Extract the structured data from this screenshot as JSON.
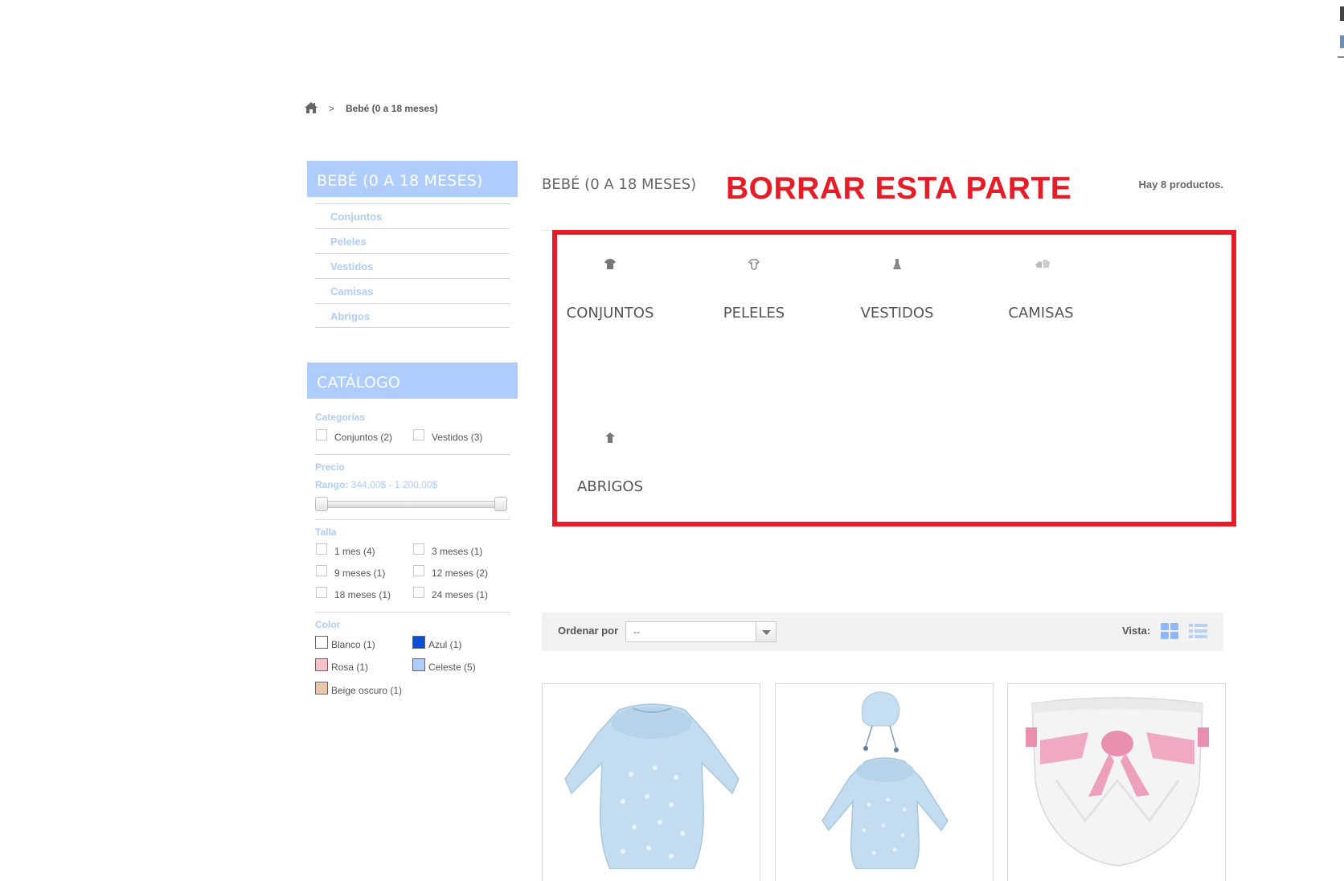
{
  "breadcrumb": {
    "separator": ">",
    "current": "Bebé (0 a 18 meses)"
  },
  "sidebar": {
    "category_block_title": "BEBÉ (0 A 18 MESES)",
    "subcategories": [
      "Conjuntos",
      "Peleles",
      "Vestidos",
      "Camisas",
      "Abrigos"
    ],
    "catalog_block_title": "CATÁLOGO"
  },
  "filters": {
    "categories": {
      "label": "Categorías",
      "options": [
        "Conjuntos (2)",
        "Vestidos (3)"
      ]
    },
    "price": {
      "label": "Precio",
      "range_label": "Rango:",
      "range_value": "344,00$ - 1 200,00$",
      "slider_low_fraction": 0,
      "slider_high_fraction": 1
    },
    "size": {
      "label": "Talla",
      "options": [
        "1 mes (4)",
        "3 meses (1)",
        "9 meses (1)",
        "12 meses (2)",
        "18 meses (1)",
        "24 meses (1)"
      ]
    },
    "color": {
      "label": "Color",
      "options": [
        {
          "label": "Blanco (1)",
          "swatch": "#ffffff"
        },
        {
          "label": "Azul (1)",
          "swatch": "#0a4fd6"
        },
        {
          "label": "Rosa (1)",
          "swatch": "#f6c1c8"
        },
        {
          "label": "Celeste (5)",
          "swatch": "#aecdfd"
        },
        {
          "label": "Beige oscuro (1)",
          "swatch": "#e8c7a8"
        }
      ]
    }
  },
  "main": {
    "title": "BEBÉ (0 A 18 MESES)",
    "annotation": "BORRAR ESTA PARTE",
    "product_count": "Hay 8 productos.",
    "subcategory_tiles": [
      {
        "label": "CONJUNTOS",
        "icon": "shirt-icon"
      },
      {
        "label": "PELELES",
        "icon": "onesie-icon"
      },
      {
        "label": "VESTIDOS",
        "icon": "dress-icon"
      },
      {
        "label": "CAMISAS",
        "icon": "baby-clothes-icon"
      },
      {
        "label": "ABRIGOS",
        "icon": "coat-icon"
      }
    ]
  },
  "sort_bar": {
    "sort_label": "Ordenar por",
    "sort_value": "--",
    "view_label": "Vista:"
  },
  "colors": {
    "accent": "#aecdfd",
    "annotation_red": "#e61c26",
    "text": "#555555"
  }
}
